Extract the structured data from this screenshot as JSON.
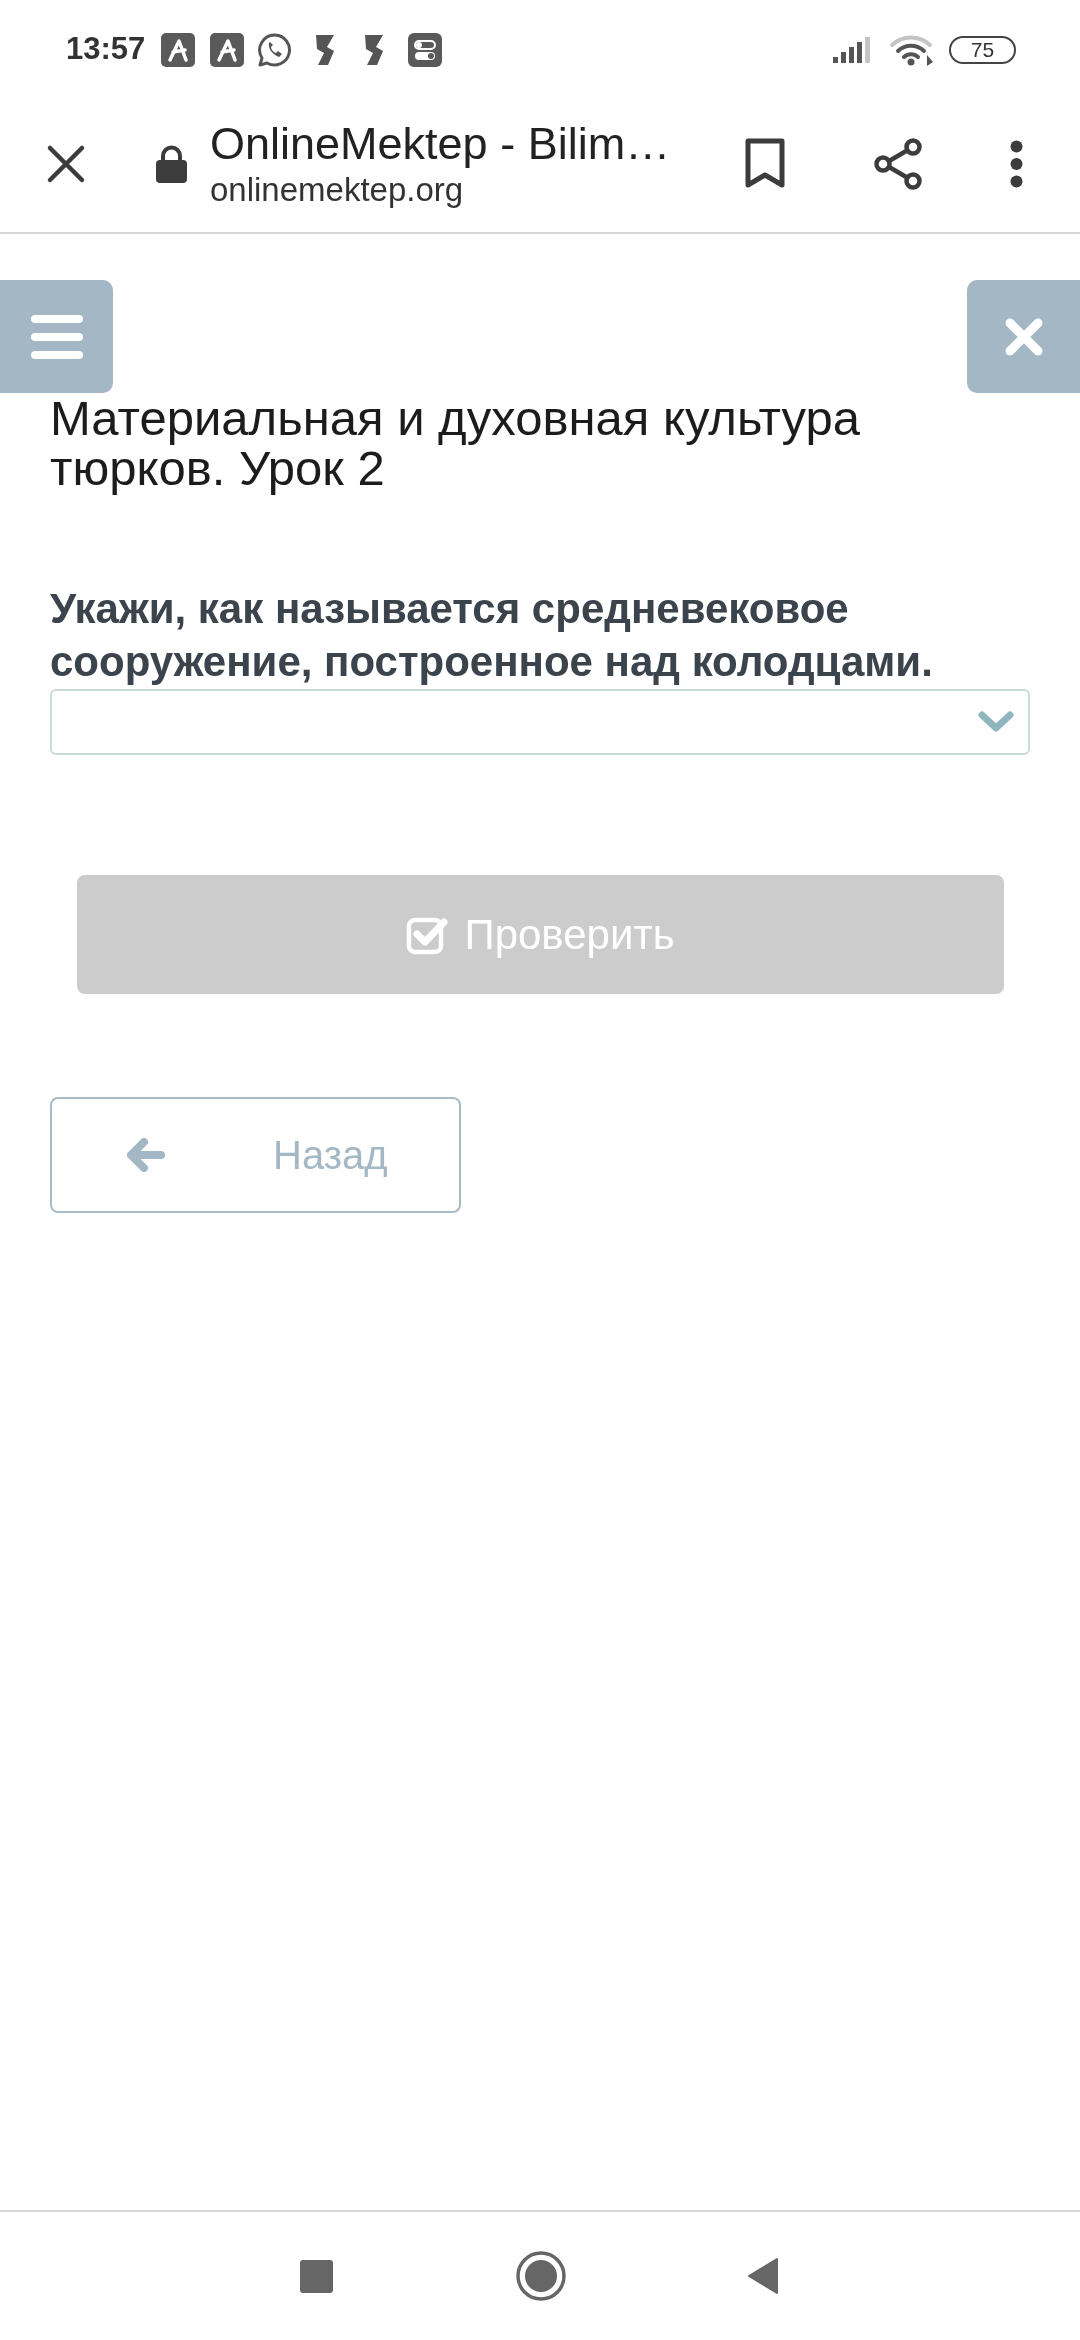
{
  "status_bar": {
    "time": "13:57",
    "battery": "75"
  },
  "browser_bar": {
    "title": "OnlineMektep - Bilim…",
    "url": "onlinemektep.org"
  },
  "lesson": {
    "title": "Материальная и духовная культура тюрков. Урок 2",
    "question": "Укажи, как называется средневековое сооружение, построенное над колодцами."
  },
  "check_button": {
    "label": "Проверить",
    "disabled": true
  },
  "back_button": {
    "label": "Назад"
  }
}
